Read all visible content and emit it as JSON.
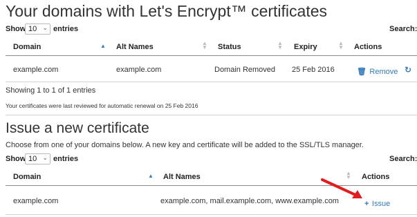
{
  "section1": {
    "title": "Your domains with Let's Encrypt™ certificates",
    "show_label": "Show",
    "entries_value": "10",
    "entries_label": "entries",
    "search_label": "Search:",
    "columns": [
      "Domain",
      "Alt Names",
      "Status",
      "Expiry",
      "Actions"
    ],
    "rows": [
      {
        "domain": "example.com",
        "alt_names": "example.com",
        "status": "Domain Removed",
        "expiry": "25 Feb 2016",
        "remove_label": "Remove"
      }
    ],
    "info": "Showing 1 to 1 of 1 entries",
    "renewal_note": "Your certificates were last reviewed for automatic renewal on",
    "renewal_date": "25 Feb 2016"
  },
  "section2": {
    "title": "Issue a new certificate",
    "description": "Choose from one of your domains below. A new key and certificate will be added to the SSL/TLS manager.",
    "show_label": "Show",
    "entries_value": "10",
    "entries_label": "entries",
    "search_label": "Search:",
    "columns": [
      "Domain",
      "Alt Names",
      "Actions"
    ],
    "rows": [
      {
        "domain": "example.com",
        "alt_names": "example.com, mail.example.com, www.example.com",
        "issue_label": "Issue"
      }
    ]
  },
  "colors": {
    "link": "#337ab7",
    "arrow": "#e01e1e",
    "text": "#333333"
  }
}
